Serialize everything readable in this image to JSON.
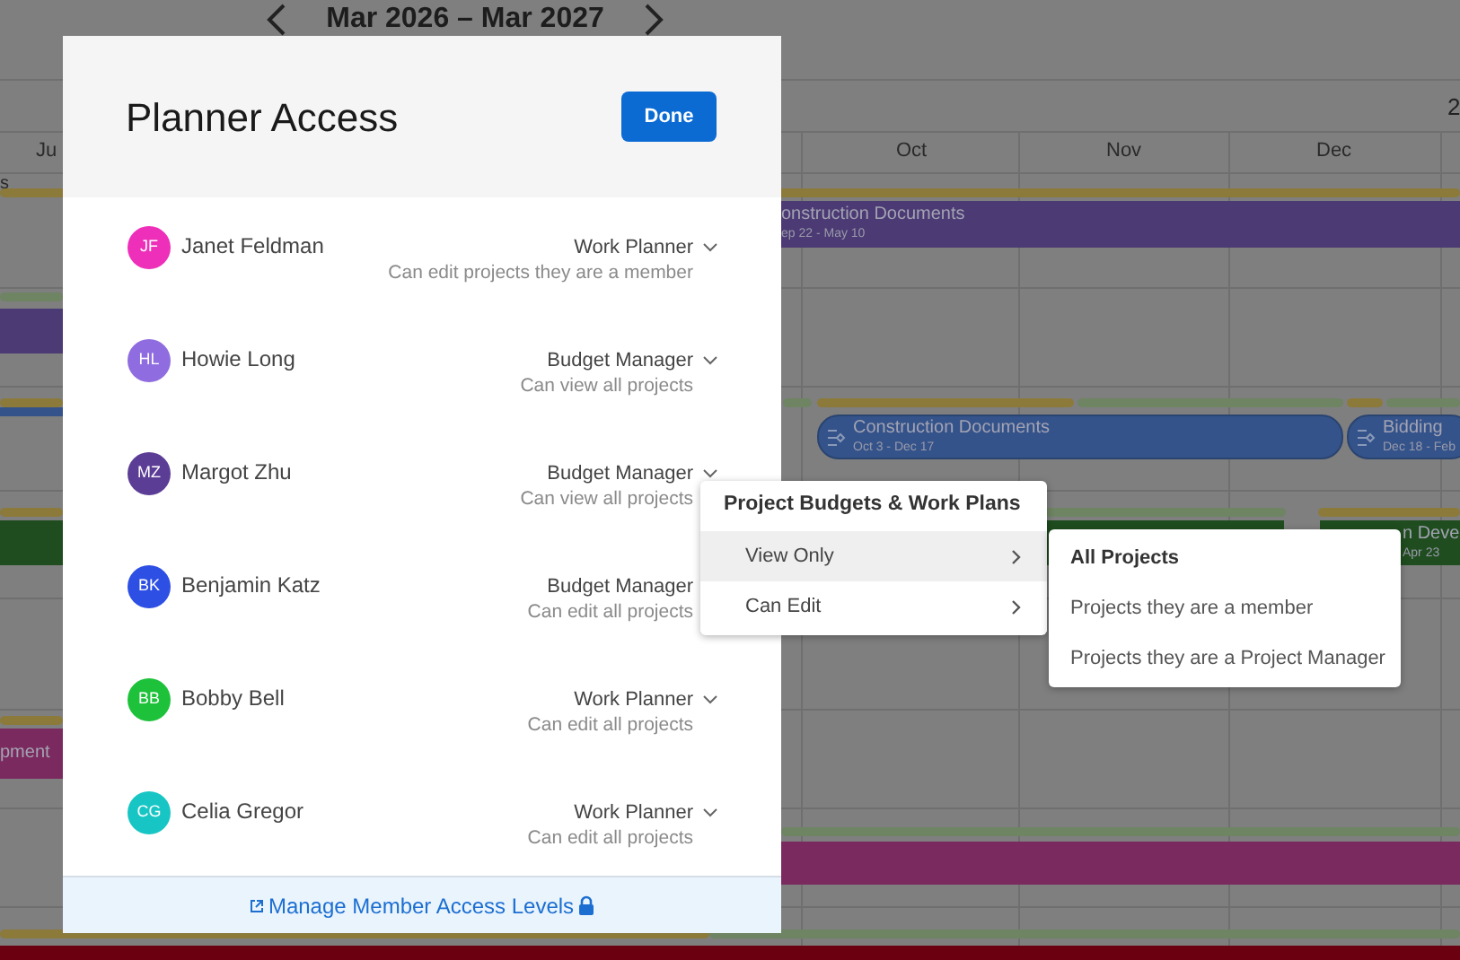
{
  "calendar": {
    "date_range": "Mar 2026 – Mar 2027",
    "corner_label": "2",
    "months": [
      "Ju",
      "Oct",
      "Nov",
      "Dec"
    ],
    "row_label": "s",
    "bars": [
      {
        "kind": "line",
        "color": "#8c7a3a"
      },
      {
        "kind": "bar",
        "color": "#4b3a73",
        "label": "onstruction Documents",
        "dates": "ep 22 - May 10"
      },
      {
        "kind": "line",
        "color": "#6e8463"
      },
      {
        "kind": "bar",
        "color": "#4b3a73"
      },
      {
        "kind": "line",
        "color": "#8c7a3a"
      },
      {
        "kind": "line",
        "color": "#6e8463"
      },
      {
        "kind": "line",
        "color": "#8c7a3a"
      },
      {
        "kind": "line",
        "color": "#6e8463"
      },
      {
        "kind": "line",
        "color": "#8c7a3a"
      },
      {
        "kind": "line",
        "color": "#6e8463"
      },
      {
        "kind": "bar",
        "color": "#34538a"
      },
      {
        "kind": "phase",
        "color": "#34538a",
        "label": "Construction Documents",
        "dates": "Oct 3 - Dec 17"
      },
      {
        "kind": "phase",
        "color": "#34538a",
        "label": "Bidding",
        "dates": "Dec 18 - Feb"
      },
      {
        "kind": "line",
        "color": "#8c7a3a"
      },
      {
        "kind": "line",
        "color": "#6e8463"
      },
      {
        "kind": "line",
        "color": "#8c7a3a"
      },
      {
        "kind": "bar",
        "color": "#1f4d1f"
      },
      {
        "kind": "bar",
        "color": "#1f4d1f"
      },
      {
        "kind": "bar",
        "color": "#1f4d1f",
        "label": "n Deve",
        "dates": "Apr 23"
      },
      {
        "kind": "line",
        "color": "#8c7a3a"
      },
      {
        "kind": "bar",
        "color": "#7b2a5f",
        "label": "pment"
      },
      {
        "kind": "line",
        "color": "#6e8463"
      },
      {
        "kind": "bar",
        "color": "#7b2a5f"
      },
      {
        "kind": "line",
        "color": "#8c7a3a"
      },
      {
        "kind": "line",
        "color": "#6e8463"
      },
      {
        "kind": "bar",
        "color": "#6a0010"
      }
    ]
  },
  "dialog": {
    "title": "Planner Access",
    "done_button": "Done",
    "members": [
      {
        "initials": "JF",
        "name": "Janet Feldman",
        "color": "#ee2fb9",
        "role": "Work Planner",
        "access": "Can edit projects they are a member",
        "dropdown_open": false
      },
      {
        "initials": "HL",
        "name": "Howie Long",
        "color": "#8f6ce0",
        "role": "Budget Manager",
        "access": "Can view all projects",
        "dropdown_open": false
      },
      {
        "initials": "MZ",
        "name": "Margot Zhu",
        "color": "#5c3d96",
        "role": "Budget Manager",
        "access": "Can view all projects",
        "dropdown_open": true
      },
      {
        "initials": "BK",
        "name": "Benjamin Katz",
        "color": "#2d4fe3",
        "role": "Budget Manager",
        "access": "Can edit all projects",
        "dropdown_open": false
      },
      {
        "initials": "BB",
        "name": "Bobby Bell",
        "color": "#1ec23a",
        "role": "Work Planner",
        "access": "Can edit all projects",
        "dropdown_open": false
      },
      {
        "initials": "CG",
        "name": "Celia Gregor",
        "color": "#17c6c4",
        "role": "Work Planner",
        "access": "Can edit all projects",
        "dropdown_open": false
      }
    ],
    "footer_link": "Manage Member Access Levels"
  },
  "menu": {
    "title": "Project Budgets & Work Plans",
    "items": [
      {
        "label": "View Only",
        "selected": true
      },
      {
        "label": "Can Edit",
        "selected": false
      }
    ]
  },
  "submenu": {
    "items": [
      {
        "label": "All Projects",
        "selected": true
      },
      {
        "label": "Projects they are a member",
        "selected": false
      },
      {
        "label": "Projects they are a Project Manager",
        "selected": false
      }
    ]
  }
}
